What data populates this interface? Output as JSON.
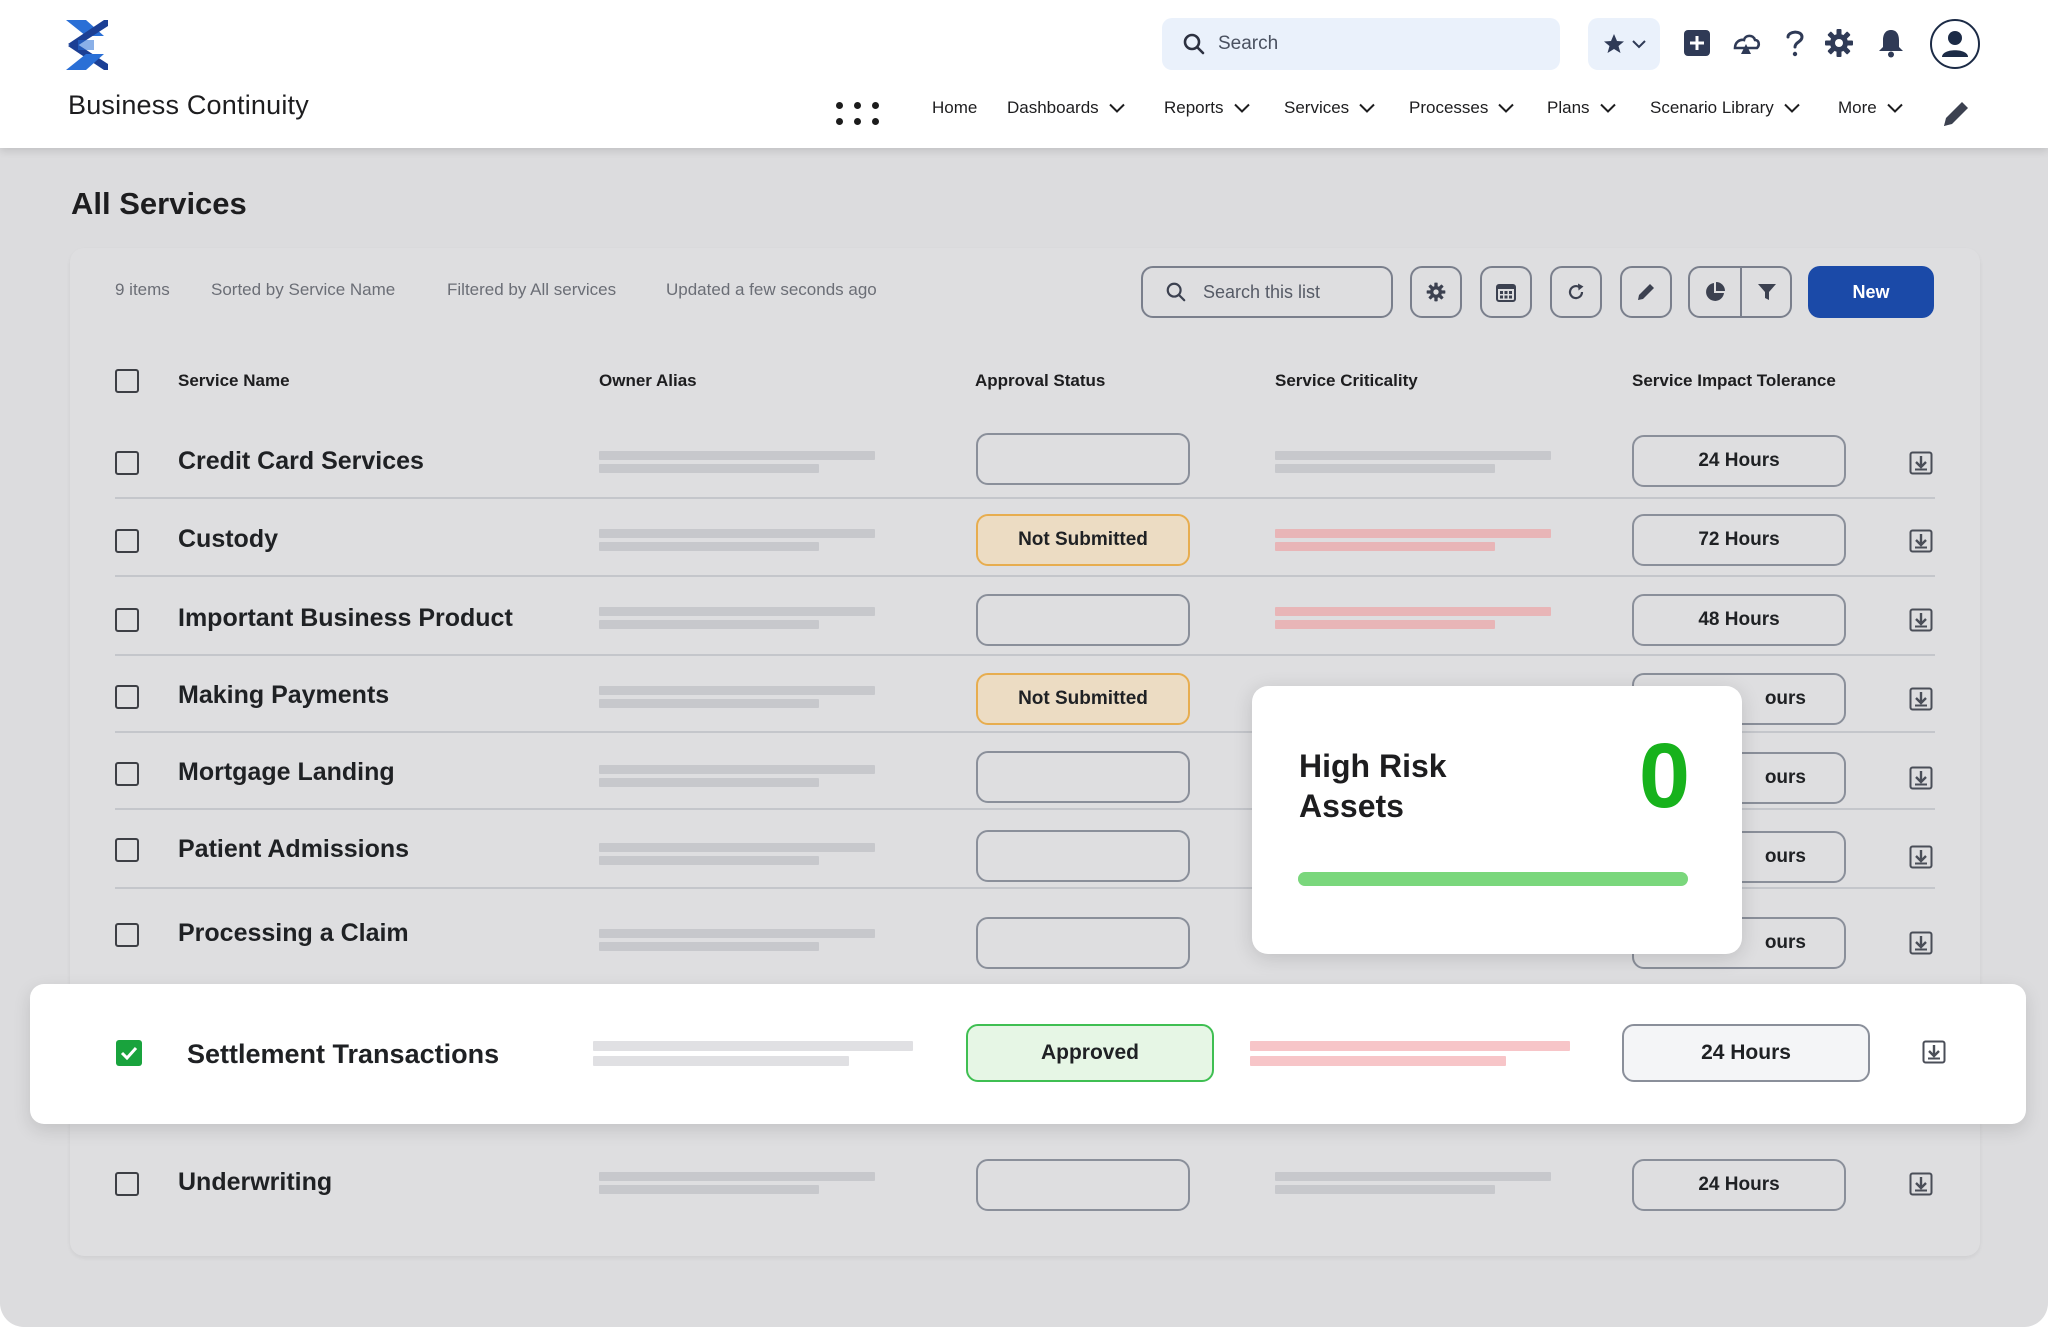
{
  "header": {
    "app_name": "Business Continuity",
    "search_placeholder": "Search",
    "nav": [
      {
        "label": "Home",
        "has_menu": false
      },
      {
        "label": "Dashboards",
        "has_menu": true
      },
      {
        "label": "Reports",
        "has_menu": true
      },
      {
        "label": "Services",
        "has_menu": true
      },
      {
        "label": "Processes",
        "has_menu": true
      },
      {
        "label": "Plans",
        "has_menu": true
      },
      {
        "label": "Scenario Library",
        "has_menu": true
      },
      {
        "label": "More",
        "has_menu": true
      }
    ]
  },
  "page": {
    "title": "All Services"
  },
  "list": {
    "meta": {
      "items": "9 items",
      "sorted": "Sorted by Service Name",
      "filtered": "Filtered by All services",
      "updated": "Updated a few seconds ago"
    },
    "search_placeholder": "Search this list",
    "new_label": "New",
    "columns": {
      "name": "Service Name",
      "owner": "Owner Alias",
      "approval": "Approval Status",
      "criticality": "Service Criticality",
      "tolerance": "Service Impact Tolerance"
    },
    "rows": [
      {
        "name": "Credit Card Services",
        "approval": "",
        "criticality_red": false,
        "tolerance": "24 Hours",
        "checked": false
      },
      {
        "name": "Custody",
        "approval": "Not Submitted",
        "criticality_red": true,
        "tolerance": "72 Hours",
        "checked": false
      },
      {
        "name": "Important Business Product",
        "approval": "",
        "criticality_red": true,
        "tolerance": "48 Hours",
        "checked": false
      },
      {
        "name": "Making Payments",
        "approval": "Not Submitted",
        "criticality_red": false,
        "tolerance": "ours",
        "checked": false
      },
      {
        "name": "Mortgage Landing",
        "approval": "",
        "criticality_red": false,
        "tolerance": "ours",
        "checked": false
      },
      {
        "name": "Patient Admissions",
        "approval": "",
        "criticality_red": false,
        "tolerance": "ours",
        "checked": false
      },
      {
        "name": "Processing a Claim",
        "approval": "",
        "criticality_red": false,
        "tolerance": "ours",
        "checked": false
      },
      {
        "name": "Settlement Transactions",
        "approval": "Approved",
        "criticality_red": true,
        "tolerance": "24 Hours",
        "checked": true
      },
      {
        "name": "Underwriting",
        "approval": "",
        "criticality_red": false,
        "tolerance": "24 Hours",
        "checked": false
      }
    ]
  },
  "popover": {
    "title": "High Risk Assets",
    "value": "0",
    "progress": 1.0
  },
  "colors": {
    "brand_blue": "#1b4aa8",
    "approved_green": "#3fbf52",
    "not_submitted_amber": "#e7ad4f",
    "risk_value_green": "#17b21c"
  }
}
